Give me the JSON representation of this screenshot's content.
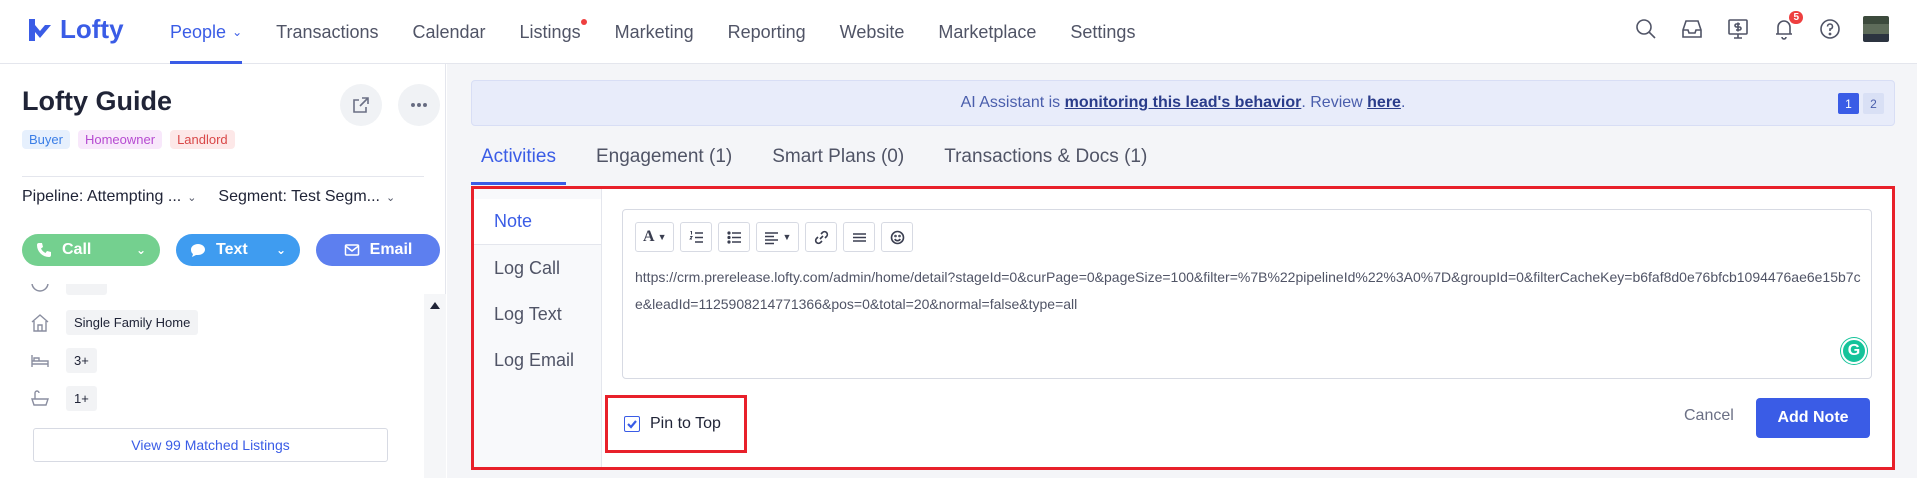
{
  "app": {
    "logo_text": "Lofty",
    "brand_color": "#3a5ce6"
  },
  "nav": {
    "items": [
      {
        "label": "People",
        "active": true,
        "has_dropdown": true
      },
      {
        "label": "Transactions"
      },
      {
        "label": "Calendar"
      },
      {
        "label": "Listings",
        "has_dot": true
      },
      {
        "label": "Marketing"
      },
      {
        "label": "Reporting"
      },
      {
        "label": "Website"
      },
      {
        "label": "Marketplace"
      },
      {
        "label": "Settings"
      }
    ],
    "icons": [
      "search-icon",
      "inbox-icon",
      "billing-icon",
      "bell-icon",
      "help-icon",
      "avatar"
    ],
    "notification_count": "5"
  },
  "lead": {
    "name": "Lofty Guide",
    "tags": [
      "Buyer",
      "Homeowner",
      "Landlord"
    ],
    "pipeline": "Pipeline: Attempting ...",
    "segment": "Segment: Test Segm...",
    "actions": {
      "call": "Call",
      "text": "Text",
      "email": "Email"
    },
    "details": {
      "property_type": "Single Family Home",
      "beds": "3+",
      "baths": "1+"
    },
    "view_listings": "View 99 Matched Listings"
  },
  "ai_banner": {
    "prefix": "AI Assistant is ",
    "link1": "monitoring this lead's behavior",
    "middle": ". Review ",
    "link2": "here",
    "suffix": ".",
    "pages": [
      "1",
      "2"
    ]
  },
  "tabs": [
    {
      "label": "Activities",
      "active": true
    },
    {
      "label": "Engagement (1)"
    },
    {
      "label": "Smart Plans (0)"
    },
    {
      "label": "Transactions & Docs (1)"
    }
  ],
  "composer": {
    "side_tabs": [
      "Note",
      "Log Call",
      "Log Text",
      "Log Email"
    ],
    "toolbar": [
      "font-icon",
      "ordered-list-icon",
      "bullet-list-icon",
      "align-icon",
      "link-icon",
      "divider-icon",
      "emoji-icon"
    ],
    "note_text": "https://crm.prerelease.lofty.com/admin/home/detail?stageId=0&curPage=0&pageSize=100&filter=%7B%22pipelineId%22%3A0%7D&groupId=0&filterCacheKey=b6faf8d0e76bfcb1094476ae6e15b7ce&leadId=1125908214771366&pos=0&total=20&normal=false&type=all",
    "pin_to_top": "Pin to Top",
    "pin_checked": true,
    "cancel": "Cancel",
    "add_note": "Add Note"
  }
}
